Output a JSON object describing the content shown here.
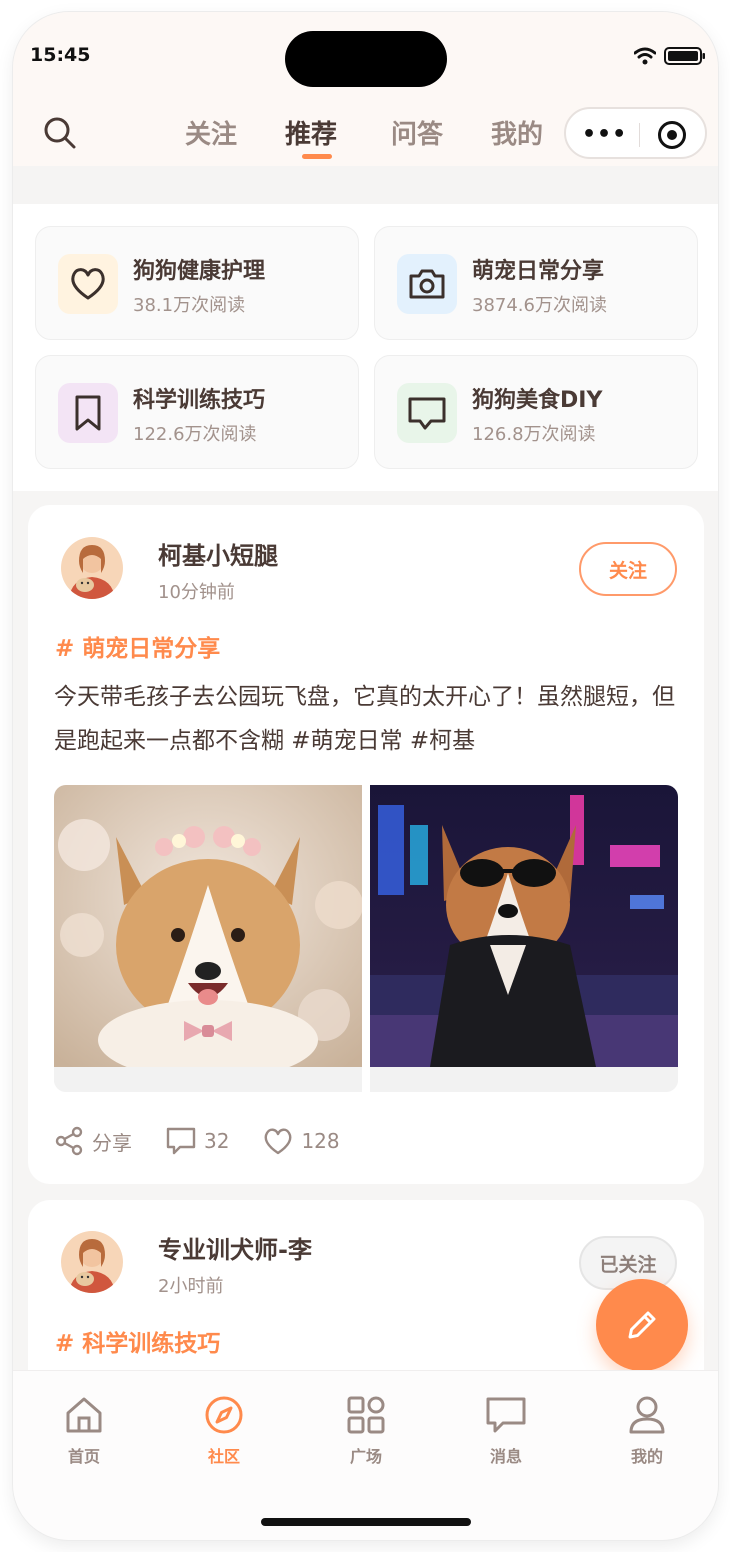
{
  "status": {
    "time": "15:45"
  },
  "nav": {
    "tabs": [
      {
        "label": "关注"
      },
      {
        "label": "推荐",
        "active": true
      },
      {
        "label": "问答"
      },
      {
        "label": "我的"
      }
    ],
    "capsule": {
      "more": "•••"
    }
  },
  "topics": [
    {
      "name": "狗狗健康护理",
      "reads": "38.1万次阅读",
      "icon": "heart-icon",
      "icon_bg": "#fff3e0"
    },
    {
      "name": "萌宠日常分享",
      "reads": "3874.6万次阅读",
      "icon": "camera-icon",
      "icon_bg": "#e3f1fd"
    },
    {
      "name": "科学训练技巧",
      "reads": "122.6万次阅读",
      "icon": "bookmark-icon",
      "icon_bg": "#f3e4f5"
    },
    {
      "name": "狗狗美食DIY",
      "reads": "126.8万次阅读",
      "icon": "message-icon",
      "icon_bg": "#e8f5e9"
    }
  ],
  "posts": [
    {
      "author": "柯基小短腿",
      "time": "10分钟前",
      "follow_label": "关注",
      "hashtag": "# 萌宠日常分享",
      "text": "今天带毛孩子去公园玩飞盘，它真的太开心了！虽然腿短，但是跑起来一点都不含糊 #萌宠日常 #柯基",
      "share_label": "分享",
      "comments": "32",
      "likes": "128"
    },
    {
      "author": "专业训犬师-李",
      "time": "2小时前",
      "follow_label": "已关注",
      "hashtag": "# 科学训练技巧"
    }
  ],
  "bottom_nav": [
    {
      "label": "首页",
      "icon": "home-icon"
    },
    {
      "label": "社区",
      "icon": "compass-icon",
      "active": true
    },
    {
      "label": "广场",
      "icon": "grid-icon"
    },
    {
      "label": "消息",
      "icon": "chat-icon"
    },
    {
      "label": "我的",
      "icon": "user-icon"
    }
  ],
  "colors": {
    "accent": "#ff8a4c",
    "text": "#4a3a35",
    "muted": "#a2928c"
  }
}
